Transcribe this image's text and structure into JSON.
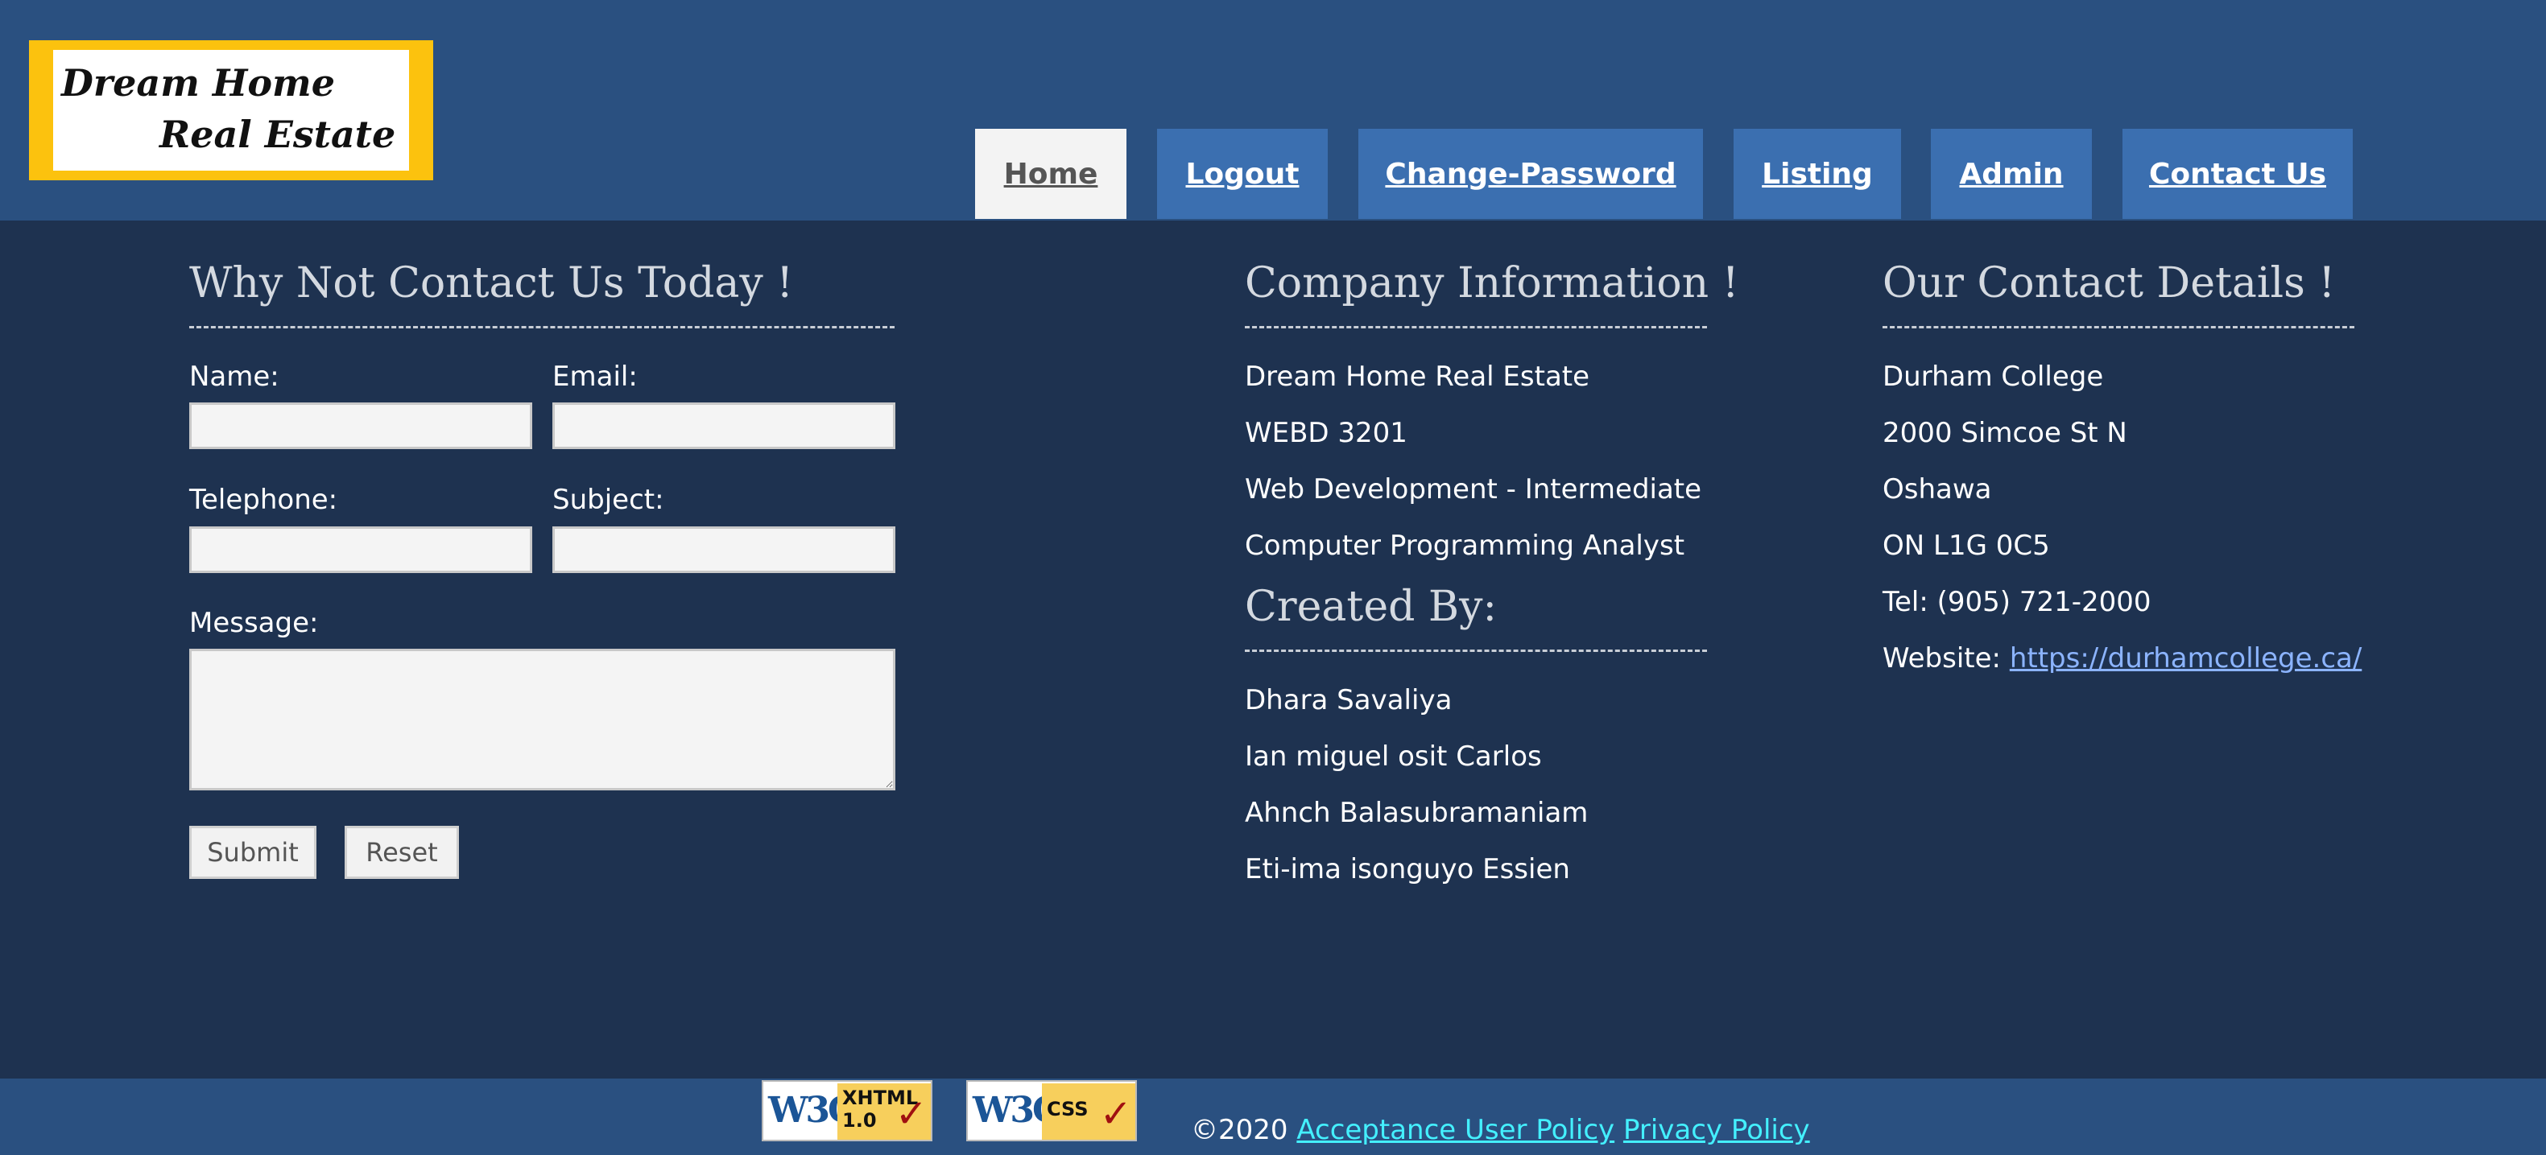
{
  "logo": {
    "line1": "Dream Home",
    "line2": "Real Estate"
  },
  "nav": {
    "items": [
      {
        "label": "Home",
        "active": true
      },
      {
        "label": "Logout",
        "active": false
      },
      {
        "label": "Change-Password",
        "active": false
      },
      {
        "label": "Listing",
        "active": false
      },
      {
        "label": "Admin",
        "active": false
      },
      {
        "label": "Contact Us",
        "active": false
      }
    ]
  },
  "contact_form": {
    "title": "Why Not Contact Us Today !",
    "name_label": "Name:",
    "email_label": "Email:",
    "telephone_label": "Telephone:",
    "subject_label": "Subject:",
    "message_label": "Message:",
    "name_value": "",
    "email_value": "",
    "telephone_value": "",
    "subject_value": "",
    "message_value": "",
    "submit_label": "Submit",
    "reset_label": "Reset"
  },
  "company": {
    "title": "Company Information !",
    "lines": [
      "Dream Home Real Estate",
      "WEBD 3201",
      "Web Development - Intermediate",
      "Computer Programming Analyst"
    ],
    "created_title": "Created By:",
    "creators": [
      "Dhara Savaliya",
      "Ian miguel osit Carlos",
      "Ahnch Balasubramaniam",
      "Eti-ima isonguyo Essien"
    ]
  },
  "contact_details": {
    "title": "Our Contact Details !",
    "lines": [
      "Durham College",
      "2000 Simcoe St N",
      "Oshawa",
      "ON L1G 0C5",
      "Tel: (905) 721-2000"
    ],
    "website_label": "Website:",
    "website_link": "https://durhamcollege.ca/"
  },
  "footer": {
    "badge_xhtml_line1": "XHTML",
    "badge_xhtml_line2": "1.0",
    "badge_css": "CSS",
    "badge_w3c": "W3C",
    "copyright": "©2020",
    "acceptance_link": "Acceptance User Policy",
    "privacy_link": "Privacy Policy"
  },
  "colors": {
    "header_bg": "#2a5080",
    "body_bg": "#1e3250",
    "nav_bg": "#3b6fb0",
    "nav_active_bg": "#f3f3f3",
    "logo_yellow": "#fcc20e",
    "footer_link": "#44f0ff"
  }
}
